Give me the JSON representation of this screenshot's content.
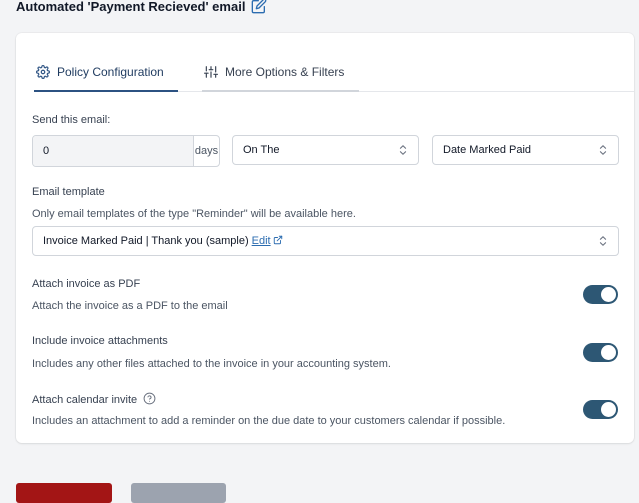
{
  "header": {
    "title": "Automated 'Payment Recieved' email",
    "edit_icon": "pencil-square-icon"
  },
  "tabs": [
    {
      "label": "Policy Configuration",
      "icon": "gear-icon",
      "active": true
    },
    {
      "label": "More Options & Filters",
      "icon": "sliders-icon",
      "active": false
    }
  ],
  "send_email": {
    "label": "Send this email:",
    "days_value": "0",
    "days_unit": "days",
    "timing_select": "On The",
    "event_select": "Date Marked Paid"
  },
  "email_template": {
    "label": "Email template",
    "help": "Only email templates of the type \"Reminder\" will be available here.",
    "selected": "Invoice Marked Paid | Thank you (sample)",
    "edit_label": "Edit"
  },
  "toggles": [
    {
      "label": "Attach invoice as PDF",
      "description": "Attach the invoice as a PDF to the email",
      "on": true
    },
    {
      "label": "Include invoice attachments",
      "description": "Includes any other files attached to the invoice in your accounting system.",
      "on": true
    },
    {
      "label": "Attach calendar invite",
      "description": "Includes an attachment to add a reminder on the due date to your customers calendar if possible.",
      "on": true,
      "help_icon": "question-circle-icon"
    }
  ],
  "colors": {
    "accent": "#2d5774",
    "danger": "#a31515",
    "link": "#2b6cb0"
  }
}
